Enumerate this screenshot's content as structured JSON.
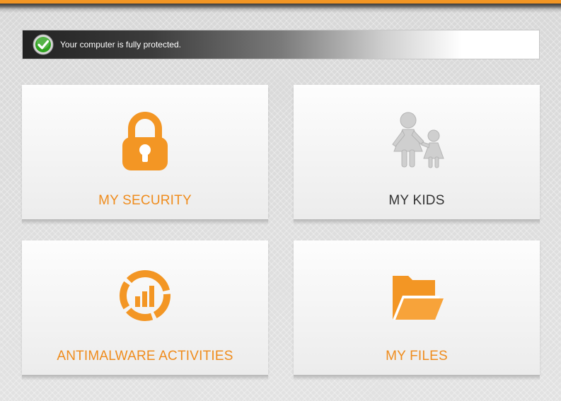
{
  "colors": {
    "accent": "#f39624",
    "label_orange": "#ef8c1d",
    "label_dark": "#333333",
    "kids_icon": "#c9c9c9",
    "status_ok": "#2fa31f"
  },
  "status": {
    "icon": "checkmark-icon",
    "message": "Your computer is fully protected."
  },
  "tiles": [
    {
      "label": "MY SECURITY",
      "icon": "lock-icon",
      "label_color": "orange"
    },
    {
      "label": "MY KIDS",
      "icon": "family-icon",
      "label_color": "dark"
    },
    {
      "label": "ANTIMALWARE ACTIVITIES",
      "icon": "activity-chart-icon",
      "label_color": "orange"
    },
    {
      "label": "MY FILES",
      "icon": "folder-icon",
      "label_color": "orange"
    }
  ]
}
